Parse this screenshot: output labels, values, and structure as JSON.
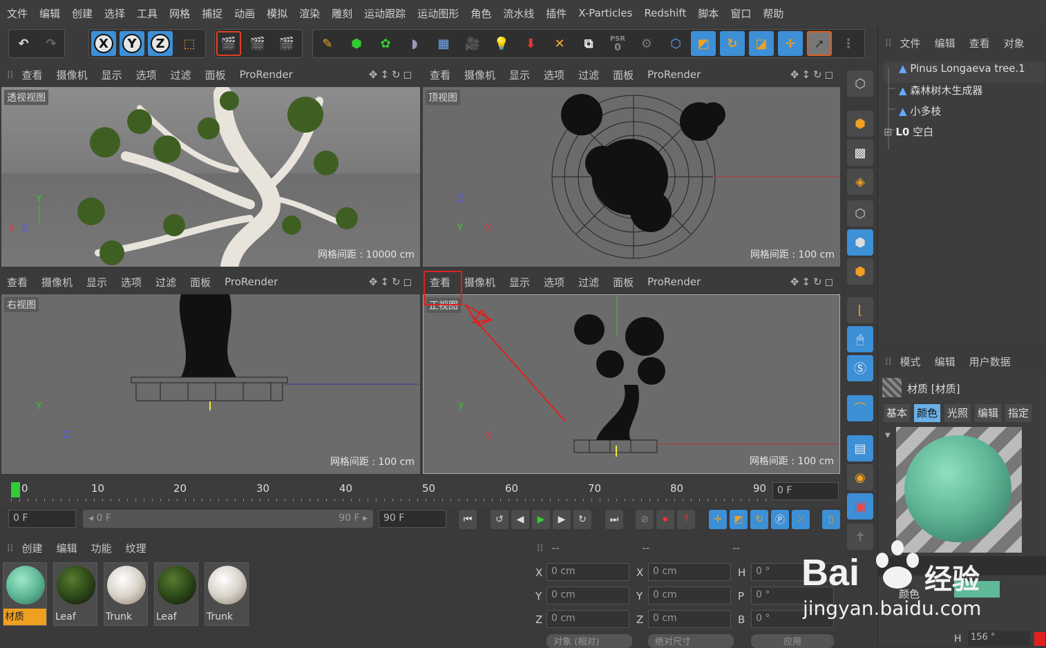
{
  "menu": [
    "文件",
    "编辑",
    "创建",
    "选择",
    "工具",
    "网格",
    "捕捉",
    "动画",
    "模拟",
    "渲染",
    "雕刻",
    "运动跟踪",
    "运动图形",
    "角色",
    "流水线",
    "插件",
    "X-Particles",
    "Redshift",
    "脚本",
    "窗口",
    "帮助"
  ],
  "toolbar": {
    "axis_x": "X",
    "axis_y": "Y",
    "axis_z": "Z",
    "psr": "PSR",
    "psr_value": "0"
  },
  "viewport_menu": [
    "查看",
    "摄像机",
    "显示",
    "选项",
    "过滤",
    "面板",
    "ProRender"
  ],
  "viewports": {
    "perspective": {
      "label": "透视视图",
      "grid": "网格间距 : 10000 cm",
      "axis_y": "Y",
      "axis_x": "X",
      "axis_z": "Z"
    },
    "top": {
      "label": "顶视图",
      "grid": "网格间距 : 100 cm",
      "axis_z": "Z",
      "axis_x": "X",
      "axis_y": "Y"
    },
    "right": {
      "label": "右视图",
      "grid": "网格间距 : 100 cm",
      "axis_y": "Y",
      "axis_z": "Z"
    },
    "front": {
      "label": "正视图",
      "grid": "网格间距 : 100 cm",
      "axis_y": "Y",
      "axis_x": "X"
    }
  },
  "object_manager": {
    "menu": [
      "文件",
      "编辑",
      "查看",
      "对象"
    ],
    "objects": [
      "Pinus Longaeva tree.1",
      "森林树木生成器",
      "小多枝",
      "空白"
    ],
    "null_icon": "L0"
  },
  "attribute_manager": {
    "menu": [
      "模式",
      "编辑",
      "用户数据"
    ],
    "title": "材质 [材质]",
    "tabs": [
      "基本",
      "颜色",
      "光照",
      "编辑",
      "指定"
    ],
    "active_tab": 1,
    "preview_color": "#5fb897",
    "partial_label": "颜色",
    "h_label": "H",
    "h_value": "156 °"
  },
  "timeline": {
    "ticks": [
      "0",
      "10",
      "20",
      "30",
      "40",
      "50",
      "60",
      "70",
      "80",
      "90"
    ],
    "current_frame": "0 F"
  },
  "transport": {
    "start": "0 F",
    "range_start": "◂ 0 F",
    "range_end": "90 F ▸",
    "end": "90 F"
  },
  "material_manager": {
    "menu": [
      "创建",
      "编辑",
      "功能",
      "纹理"
    ],
    "materials": [
      {
        "name": "材质",
        "color": "#5fb897",
        "selected": true
      },
      {
        "name": "Leaf",
        "color": "#2d4a18",
        "selected": false
      },
      {
        "name": "Trunk",
        "color": "#d8d2c8",
        "selected": false
      },
      {
        "name": "Leaf",
        "color": "#2d4a18",
        "selected": false
      },
      {
        "name": "Trunk",
        "color": "#d8d2c8",
        "selected": false
      }
    ]
  },
  "coordinates": {
    "header": [
      "--",
      "--",
      "--"
    ],
    "rows": [
      {
        "a": "X",
        "av": "0 cm",
        "b": "X",
        "bv": "0 cm",
        "c": "H",
        "cv": "0 °"
      },
      {
        "a": "Y",
        "av": "0 cm",
        "b": "Y",
        "bv": "0 cm",
        "c": "P",
        "cv": "0 °"
      },
      {
        "a": "Z",
        "av": "0 cm",
        "b": "Z",
        "bv": "0 cm",
        "c": "B",
        "cv": "0 °"
      }
    ],
    "buttons": [
      "对象 (相对)",
      "绝对尺寸",
      "应用"
    ]
  },
  "watermark": {
    "brand": "Bai",
    "brand_cn": "经验",
    "url": "jingyan.baidu.com"
  },
  "colors": {
    "accent_blue": "#3d8fd6",
    "highlight_red": "#e02020",
    "selected_orange": "#f0a020"
  }
}
